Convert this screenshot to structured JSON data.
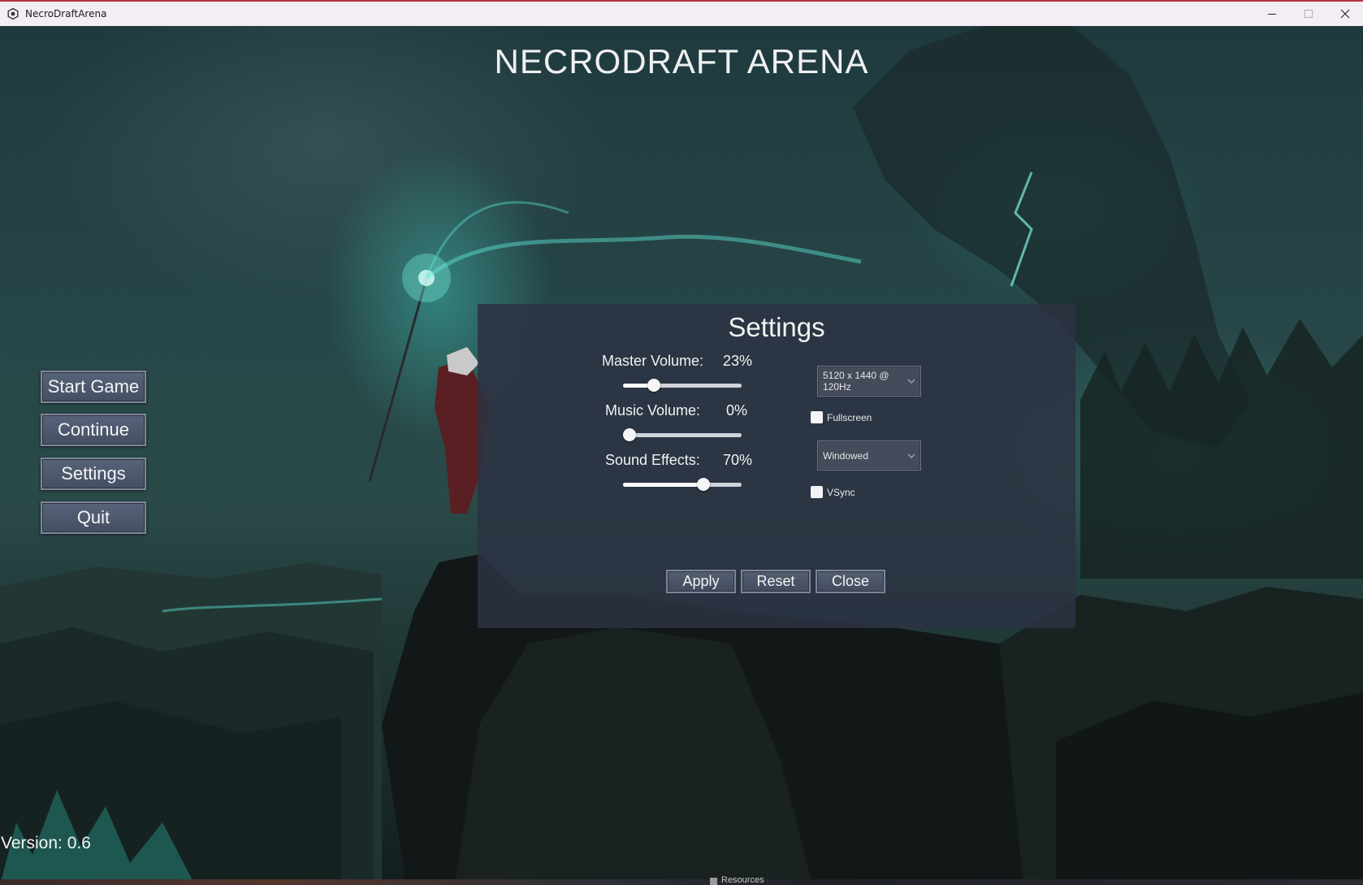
{
  "window": {
    "title": "NecroDraftArena",
    "app_icon": "gear-hex-icon",
    "controls": [
      "minimize-icon",
      "maximize-icon",
      "close-icon"
    ]
  },
  "game": {
    "title": "NECRODRAFT ARENA",
    "version": "Version: 0.6"
  },
  "main_menu": {
    "items": [
      {
        "label": "Start Game"
      },
      {
        "label": "Continue"
      },
      {
        "label": "Settings"
      },
      {
        "label": "Quit"
      }
    ]
  },
  "settings": {
    "title": "Settings",
    "master_volume": {
      "label": "Master Volume:",
      "value": "23%",
      "level": 0.23
    },
    "music_volume": {
      "label": "Music Volume:",
      "value": "0%",
      "level": 0.0
    },
    "sound_effects": {
      "label": "Sound Effects:",
      "value": "70%",
      "level": 0.7
    },
    "resolution": {
      "selected": "5120 x 1440 @ 120Hz"
    },
    "fullscreen": {
      "label": "Fullscreen",
      "checked": false
    },
    "window_mode": {
      "selected": "Windowed"
    },
    "vsync": {
      "label": "VSync",
      "checked": false
    },
    "buttons": {
      "apply": "Apply",
      "reset": "Reset",
      "close": "Close"
    }
  },
  "taskbar": {
    "item": "Resources"
  },
  "colors": {
    "accent_glow": "#46e6d2",
    "panel_bg": "#2c3242",
    "button_bg": "#4d576b",
    "text": "#f2f2f2"
  }
}
